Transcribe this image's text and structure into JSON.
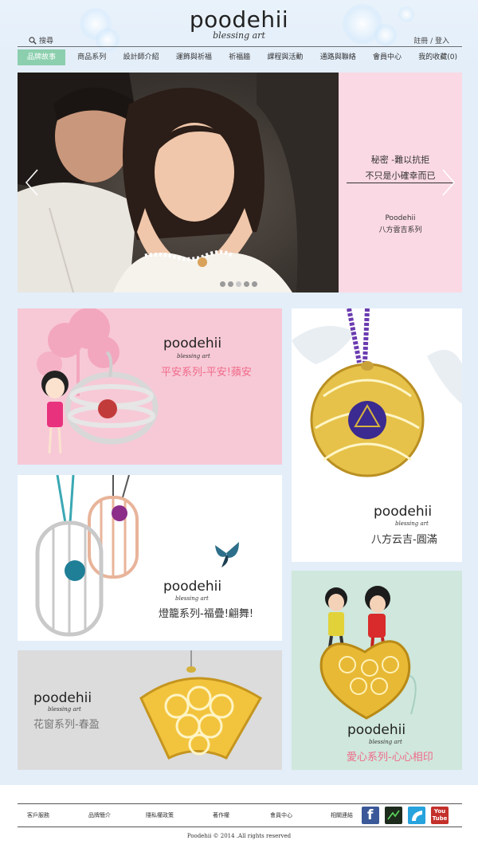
{
  "header": {
    "logo": "poodehii",
    "tagline": "blessing art",
    "search_label": "搜尋",
    "login_label": "註冊 / 登入"
  },
  "nav": {
    "items": [
      {
        "label": "品牌故事",
        "active": true
      },
      {
        "label": "商品系列"
      },
      {
        "label": "設計師介紹"
      },
      {
        "label": "運飾與祈福"
      },
      {
        "label": "祈福牆"
      },
      {
        "label": "課程與活動"
      },
      {
        "label": "通路與聯絡"
      },
      {
        "label": "會員中心"
      },
      {
        "label": "我的收藏(0)"
      }
    ]
  },
  "hero": {
    "line1": "秘密 -難以抗拒",
    "line2": "不只是小確幸而已",
    "line3": "Poodehii",
    "line4": "八方雲吉系列",
    "dots": 5,
    "active_dot": 3
  },
  "tiles": {
    "t1": {
      "brand": "poodehii",
      "sub": "blessing art",
      "caption": "平安系列-平安!蘋安"
    },
    "t2": {
      "brand": "poodehii",
      "sub": "blessing art",
      "caption": "八方云吉-圓滿"
    },
    "t3": {
      "brand": "poodehii",
      "sub": "blessing art",
      "caption": "燈籠系列-福疊!翩舞!"
    },
    "t4": {
      "brand": "poodehii",
      "sub": "blessing art",
      "caption": "花窗系列-春盈"
    },
    "t5": {
      "brand": "poodehii",
      "sub": "blessing art",
      "caption": "愛心系列-心心相印"
    }
  },
  "footer": {
    "links": [
      "客戶服務",
      "品牌簡介",
      "隱私權政策",
      "著作權",
      "會員中心",
      "相關連結"
    ],
    "social": [
      {
        "icon": "facebook-icon",
        "label": "f",
        "color": "#3b5998"
      },
      {
        "icon": "blog-icon",
        "label": "",
        "color": "#1d2b1d"
      },
      {
        "icon": "feed-icon",
        "label": "",
        "color": "#27a3dd"
      },
      {
        "icon": "youtube-icon",
        "label": "You Tube",
        "color": "#c4302b"
      }
    ],
    "copyright": "Poodehii © 2014 .All rights reserved"
  },
  "colors": {
    "page_bg": "#e3eef9",
    "nav_active": "#8ccfae",
    "pink_panel": "#fbd9e4",
    "caption_pink": "#f06a8a",
    "caption_gray": "#777777",
    "caption_dark": "#333333"
  }
}
